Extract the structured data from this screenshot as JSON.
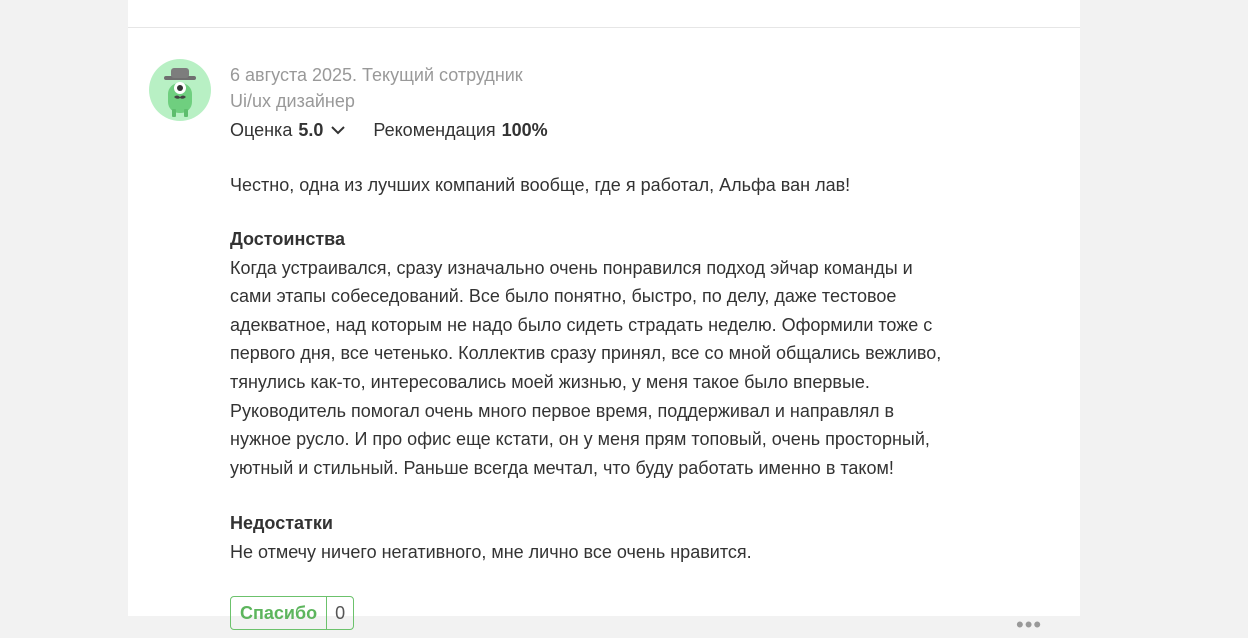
{
  "review": {
    "date_status": "6 августа 2025. Текущий сотрудник",
    "position": "Ui/ux дизайнер",
    "rating_label": "Оценка",
    "rating_value": "5.0",
    "recommend_label": "Рекомендация",
    "recommend_value": "100%",
    "intro": "Честно, одна из лучших компаний вообще, где я работал, Альфа ван лав!",
    "pros_title": "Достоинства",
    "pros_text": "Когда устраивался, сразу изначально очень понравился подход эйчар команды и сами этапы собеседований. Все было понятно, быстро, по делу, даже тестовое адекватное, над которым не надо было сидеть страдать неделю. Оформили тоже с первого дня, все четенько. Коллектив сразу принял, все со мной общались вежливо, тянулись как-то, интересовались моей жизнью, у меня такое было впервые. Руководитель помогал очень много первое время, поддерживал и направлял в нужное русло. И про офис еще кстати, он у меня прям топовый, очень просторный, уютный и стильный. Раньше всегда мечтал, что буду работать именно в таком!",
    "cons_title": "Недостатки",
    "cons_text": "Не отмечу ничего негативного, мне лично все очень нравится.",
    "thanks_label": "Спасибо",
    "thanks_count": "0"
  },
  "icons": {
    "avatar": "avatar-icon",
    "chevron": "chevron-down-icon",
    "more": "more-dots-icon"
  },
  "colors": {
    "accent_green": "#5db55d",
    "avatar_bg": "#b8f0c4",
    "meta_gray": "#999999"
  }
}
